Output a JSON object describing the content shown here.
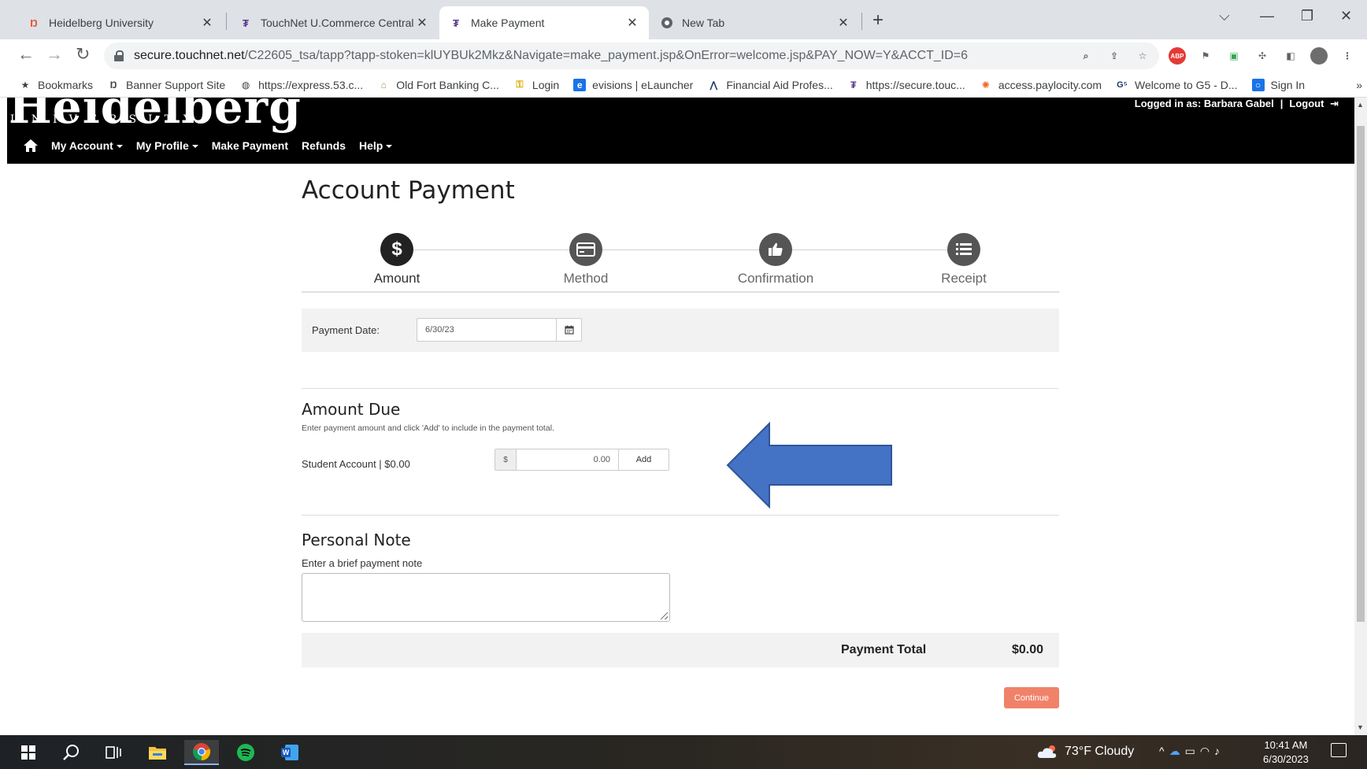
{
  "browser": {
    "tabs": [
      {
        "title": "Heidelberg University",
        "favicon": "heidelberg-favicon"
      },
      {
        "title": "TouchNet U.Commerce Central",
        "favicon": "touchnet-favicon"
      },
      {
        "title": "Make Payment",
        "favicon": "touchnet-favicon",
        "active": true
      },
      {
        "title": "New Tab",
        "favicon": "chrome-favicon"
      }
    ],
    "url_host": "secure.touchnet.net",
    "url_path": "/C22605_tsa/tapp?tapp-stoken=klUYBUk2Mkz&Navigate=make_payment.jsp&OnError=welcome.jsp&PAY_NOW=Y&ACCT_ID=6",
    "bookmarks": [
      {
        "label": "Bookmarks",
        "icon": "star-icon"
      },
      {
        "label": "Banner Support Site",
        "icon": "banner-icon"
      },
      {
        "label": "https://express.53.c...",
        "icon": "globe-icon"
      },
      {
        "label": "Old Fort Banking C...",
        "icon": "bank-icon"
      },
      {
        "label": "Login",
        "icon": "key-icon"
      },
      {
        "label": "evisions | eLauncher",
        "icon": "evisions-icon"
      },
      {
        "label": "Financial Aid Profes...",
        "icon": "finaid-icon"
      },
      {
        "label": "https://secure.touc...",
        "icon": "touchnet-icon"
      },
      {
        "label": "access.paylocity.com",
        "icon": "paylocity-icon"
      },
      {
        "label": "Welcome to G5 - D...",
        "icon": "g5-icon"
      },
      {
        "label": "Sign In",
        "icon": "signin-icon"
      }
    ],
    "more_bookmarks": "»"
  },
  "site": {
    "logo_text": "Heidelberg",
    "logo_sub": "UNIVERSITY",
    "user_label": "Logged in as: Barbara Gabel",
    "logout_label": "Logout",
    "nav": [
      {
        "label": "My Account",
        "dropdown": true
      },
      {
        "label": "My Profile",
        "dropdown": true
      },
      {
        "label": "Make Payment",
        "dropdown": false
      },
      {
        "label": "Refunds",
        "dropdown": false
      },
      {
        "label": "Help",
        "dropdown": true
      }
    ]
  },
  "page": {
    "title": "Account Payment",
    "steps": [
      {
        "label": "Amount",
        "icon": "dollar-icon",
        "state": "active"
      },
      {
        "label": "Method",
        "icon": "credit-card-icon",
        "state": "pending"
      },
      {
        "label": "Confirmation",
        "icon": "thumbs-up-icon",
        "state": "pending"
      },
      {
        "label": "Receipt",
        "icon": "list-icon",
        "state": "pending"
      }
    ],
    "payment_date_label": "Payment Date:",
    "payment_date_value": "6/30/23",
    "amount_due": {
      "heading": "Amount Due",
      "hint": "Enter payment amount and click 'Add' to include in the payment total.",
      "account_label": "Student Account | $0.00",
      "currency_symbol": "$",
      "amount_value": "0.00",
      "add_label": "Add"
    },
    "annotation": {
      "shape": "arrow-left",
      "color": "#4472c4"
    },
    "personal_note": {
      "heading": "Personal Note",
      "hint": "Enter a brief payment note",
      "value": ""
    },
    "payment_total_label": "Payment Total",
    "payment_total_value": "$0.00",
    "continue_label": "Continue",
    "colors": {
      "continue": "#f0826a",
      "header_bg": "#000000",
      "panel_bg": "#f2f2f2"
    }
  },
  "taskbar": {
    "weather_temp": "73°F",
    "weather_desc": "Cloudy",
    "time": "10:41 AM",
    "date": "6/30/2023"
  }
}
